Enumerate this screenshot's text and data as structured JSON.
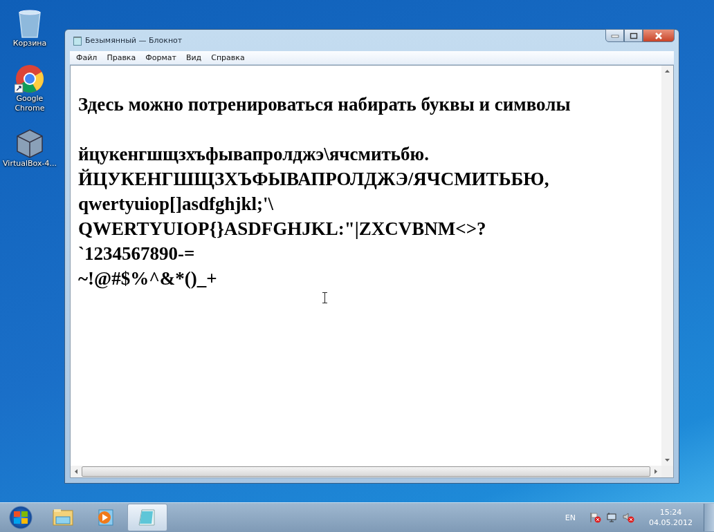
{
  "desktop_icons": [
    {
      "kind": "recycle-bin",
      "label": "Корзина"
    },
    {
      "kind": "chrome",
      "label": "Google Chrome"
    },
    {
      "kind": "virtualbox",
      "label": "VirtualBox-4..."
    }
  ],
  "window": {
    "title": "Безымянный — Блокнот",
    "menu": [
      "Файл",
      "Правка",
      "Формат",
      "Вид",
      "Справка"
    ],
    "document": {
      "heading": "Здесь можно потренироваться набирать буквы и символы",
      "lines": [
        "йцукенгшщзхъфывапролджэ\\ячсмитьбю.",
        "ЙЦУКЕНГШЩЗХЪФЫВАПРОЛДЖЭ/ЯЧСМИТЬБЮ,",
        "qwertyuiop[]asdfghjkl;'\\",
        "QWERTYUIOP{}ASDFGHJKL:\"|ZXCVBNM<>?",
        "`1234567890-=",
        "~!@#$%^&*()_+"
      ]
    }
  },
  "taskbar": {
    "apps": [
      {
        "kind": "explorer",
        "selected": false
      },
      {
        "kind": "media-player",
        "selected": false
      },
      {
        "kind": "notepad",
        "selected": true
      }
    ],
    "language": "EN",
    "time": "15:24",
    "date": "04.05.2012"
  }
}
